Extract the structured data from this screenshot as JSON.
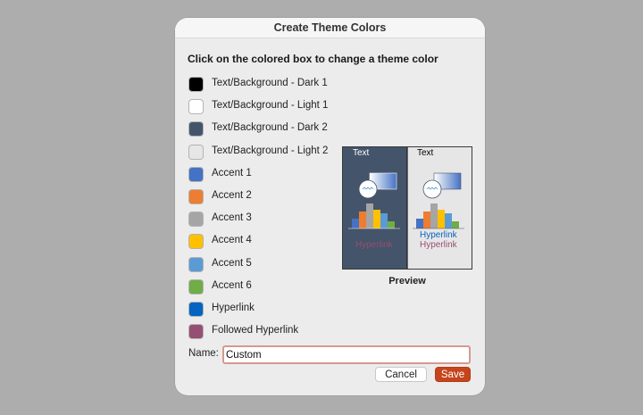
{
  "dialog": {
    "title": "Create Theme Colors",
    "instruction": "Click on the colored box to change a theme color",
    "colors": [
      {
        "label": "Text/Background - Dark 1",
        "color": "#000000"
      },
      {
        "label": "Text/Background - Light 1",
        "color": "#ffffff"
      },
      {
        "label": "Text/Background - Dark 2",
        "color": "#44546a"
      },
      {
        "label": "Text/Background - Light 2",
        "color": "#e7e6e6"
      },
      {
        "label": "Accent 1",
        "color": "#4472c4"
      },
      {
        "label": "Accent 2",
        "color": "#ed7d31"
      },
      {
        "label": "Accent 3",
        "color": "#a5a5a5"
      },
      {
        "label": "Accent 4",
        "color": "#ffc000"
      },
      {
        "label": "Accent 5",
        "color": "#5b9bd5"
      },
      {
        "label": "Accent 6",
        "color": "#70ad47"
      },
      {
        "label": "Hyperlink",
        "color": "#0563c1"
      },
      {
        "label": "Followed Hyperlink",
        "color": "#954f72"
      }
    ],
    "preview": {
      "label": "Preview",
      "dark_panel": {
        "text": "Text",
        "hyperlink": "Hyperlink"
      },
      "light_panel": {
        "text": "Text",
        "hyperlink": "Hyperlink",
        "followed_hyperlink": "Hyperlink"
      }
    },
    "name_field": {
      "label": "Name:",
      "value": "Custom"
    },
    "buttons": {
      "cancel": "Cancel",
      "save": "Save"
    }
  }
}
